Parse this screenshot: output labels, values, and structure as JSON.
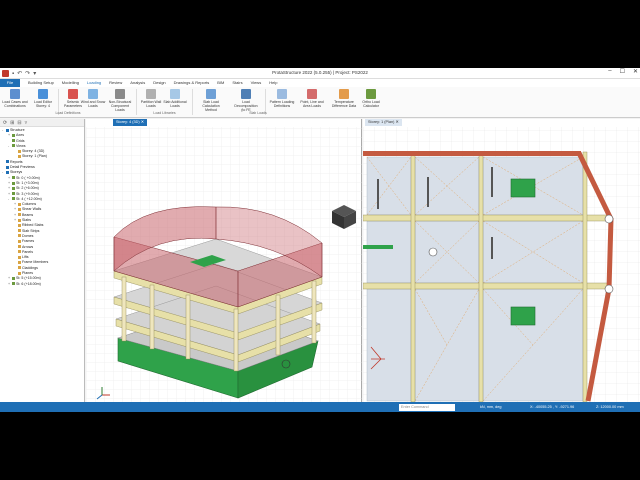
{
  "window": {
    "title": "ProtaStructure 2022 (5.0.255) | Project: PS2022",
    "controls": [
      "–",
      "☐",
      "✕"
    ]
  },
  "ribbon": {
    "file_tab": "File",
    "tabs": [
      "Building Setup",
      "Modelling",
      "Loading",
      "Review",
      "Analysis",
      "Design",
      "Drawings & Reports",
      "BIM",
      "Stairs",
      "Views",
      "Help"
    ],
    "active_tab": "Loading",
    "buttons": [
      {
        "label": "Load Cases and Combinations",
        "icon": "load-cases-icon"
      },
      {
        "label": "Load Editor Storey: 4",
        "icon": "load-editor-icon"
      },
      {
        "label": "Seismic Parameters",
        "icon": "seismic-icon"
      },
      {
        "label": "Wind and Snow Loads",
        "icon": "wind-icon"
      },
      {
        "label": "Non-Structural Component Loads",
        "icon": "component-loads-icon"
      },
      {
        "label": "Partition Wall Loads",
        "icon": "partition-icon"
      },
      {
        "label": "Slab Additional Loads",
        "icon": "slab-additional-icon"
      },
      {
        "label": "Slab Load Calculation Method",
        "icon": "slab-calc-icon"
      },
      {
        "label": "Load Decomposition (to FE",
        "icon": "decomposition-icon"
      },
      {
        "label": "Pattern Loading Definitions",
        "icon": "pattern-icon"
      },
      {
        "label": "Point, Line and Area Loads",
        "icon": "point-line-icon"
      },
      {
        "label": "Temperature Difference Data",
        "icon": "temperature-icon"
      },
      {
        "label": "Ortho Load Calculator",
        "icon": "calculator-icon"
      }
    ],
    "groups": [
      "Load Definitions",
      "Load Libraries",
      "Slab Loads"
    ]
  },
  "tree": {
    "nodes": [
      {
        "label": "Structure",
        "depth": 0,
        "toggle": "-"
      },
      {
        "label": "Axes",
        "depth": 1,
        "toggle": "+"
      },
      {
        "label": "Grids",
        "depth": 1,
        "toggle": ""
      },
      {
        "label": "Views",
        "depth": 1,
        "toggle": "-"
      },
      {
        "label": "Storey: 4 (3D)",
        "depth": 2,
        "toggle": ""
      },
      {
        "label": "Storey: 1 (Plan)",
        "depth": 2,
        "toggle": ""
      },
      {
        "label": "Reports",
        "depth": 0,
        "toggle": ""
      },
      {
        "label": "Detail Previews",
        "depth": 0,
        "toggle": ""
      },
      {
        "label": "Storeys",
        "depth": 0,
        "toggle": "-"
      },
      {
        "label": "St: 0 ( +0.00m)",
        "depth": 1,
        "toggle": "+"
      },
      {
        "label": "St: 1 (+3.00m)",
        "depth": 1,
        "toggle": "+"
      },
      {
        "label": "St: 2 (+6.00m)",
        "depth": 1,
        "toggle": "+"
      },
      {
        "label": "St: 3 (+9.00m)",
        "depth": 1,
        "toggle": "+"
      },
      {
        "label": "St: 4 ( +12.00m)",
        "depth": 1,
        "toggle": "-"
      },
      {
        "label": "Columns",
        "depth": 2,
        "toggle": "+"
      },
      {
        "label": "Shear Walls",
        "depth": 2,
        "toggle": "+"
      },
      {
        "label": "Beams",
        "depth": 2,
        "toggle": "+"
      },
      {
        "label": "Slabs",
        "depth": 2,
        "toggle": "+"
      },
      {
        "label": "Ribbed Slabs",
        "depth": 2,
        "toggle": ""
      },
      {
        "label": "Slab Strips",
        "depth": 2,
        "toggle": ""
      },
      {
        "label": "Domes",
        "depth": 2,
        "toggle": ""
      },
      {
        "label": "Frames",
        "depth": 2,
        "toggle": ""
      },
      {
        "label": "Arrows",
        "depth": 2,
        "toggle": ""
      },
      {
        "label": "Panels",
        "depth": 2,
        "toggle": ""
      },
      {
        "label": "Lifts",
        "depth": 2,
        "toggle": ""
      },
      {
        "label": "Frame Members",
        "depth": 2,
        "toggle": ""
      },
      {
        "label": "Claddings",
        "depth": 2,
        "toggle": ""
      },
      {
        "label": "Planes",
        "depth": 2,
        "toggle": ""
      },
      {
        "label": "St: 5 (+15.00m)",
        "depth": 1,
        "toggle": "+"
      },
      {
        "label": "St: 6 (+18.00m)",
        "depth": 1,
        "toggle": "+"
      }
    ]
  },
  "views": {
    "tab3d": "Storey: 4 (3D)",
    "tab2d": "Storey: 1 (Plan)"
  },
  "statusbar": {
    "command_placeholder": "Enter Command",
    "units": "kN, mm, deg",
    "coords": "X: -40055.25 , Y: -9271.96",
    "z": "Z: 12000.00 mm"
  },
  "colors": {
    "brand": "#1f6fb5",
    "green_slab": "#2fa24a",
    "beam": "#e7e0a8",
    "cladding": "#c9666d"
  }
}
